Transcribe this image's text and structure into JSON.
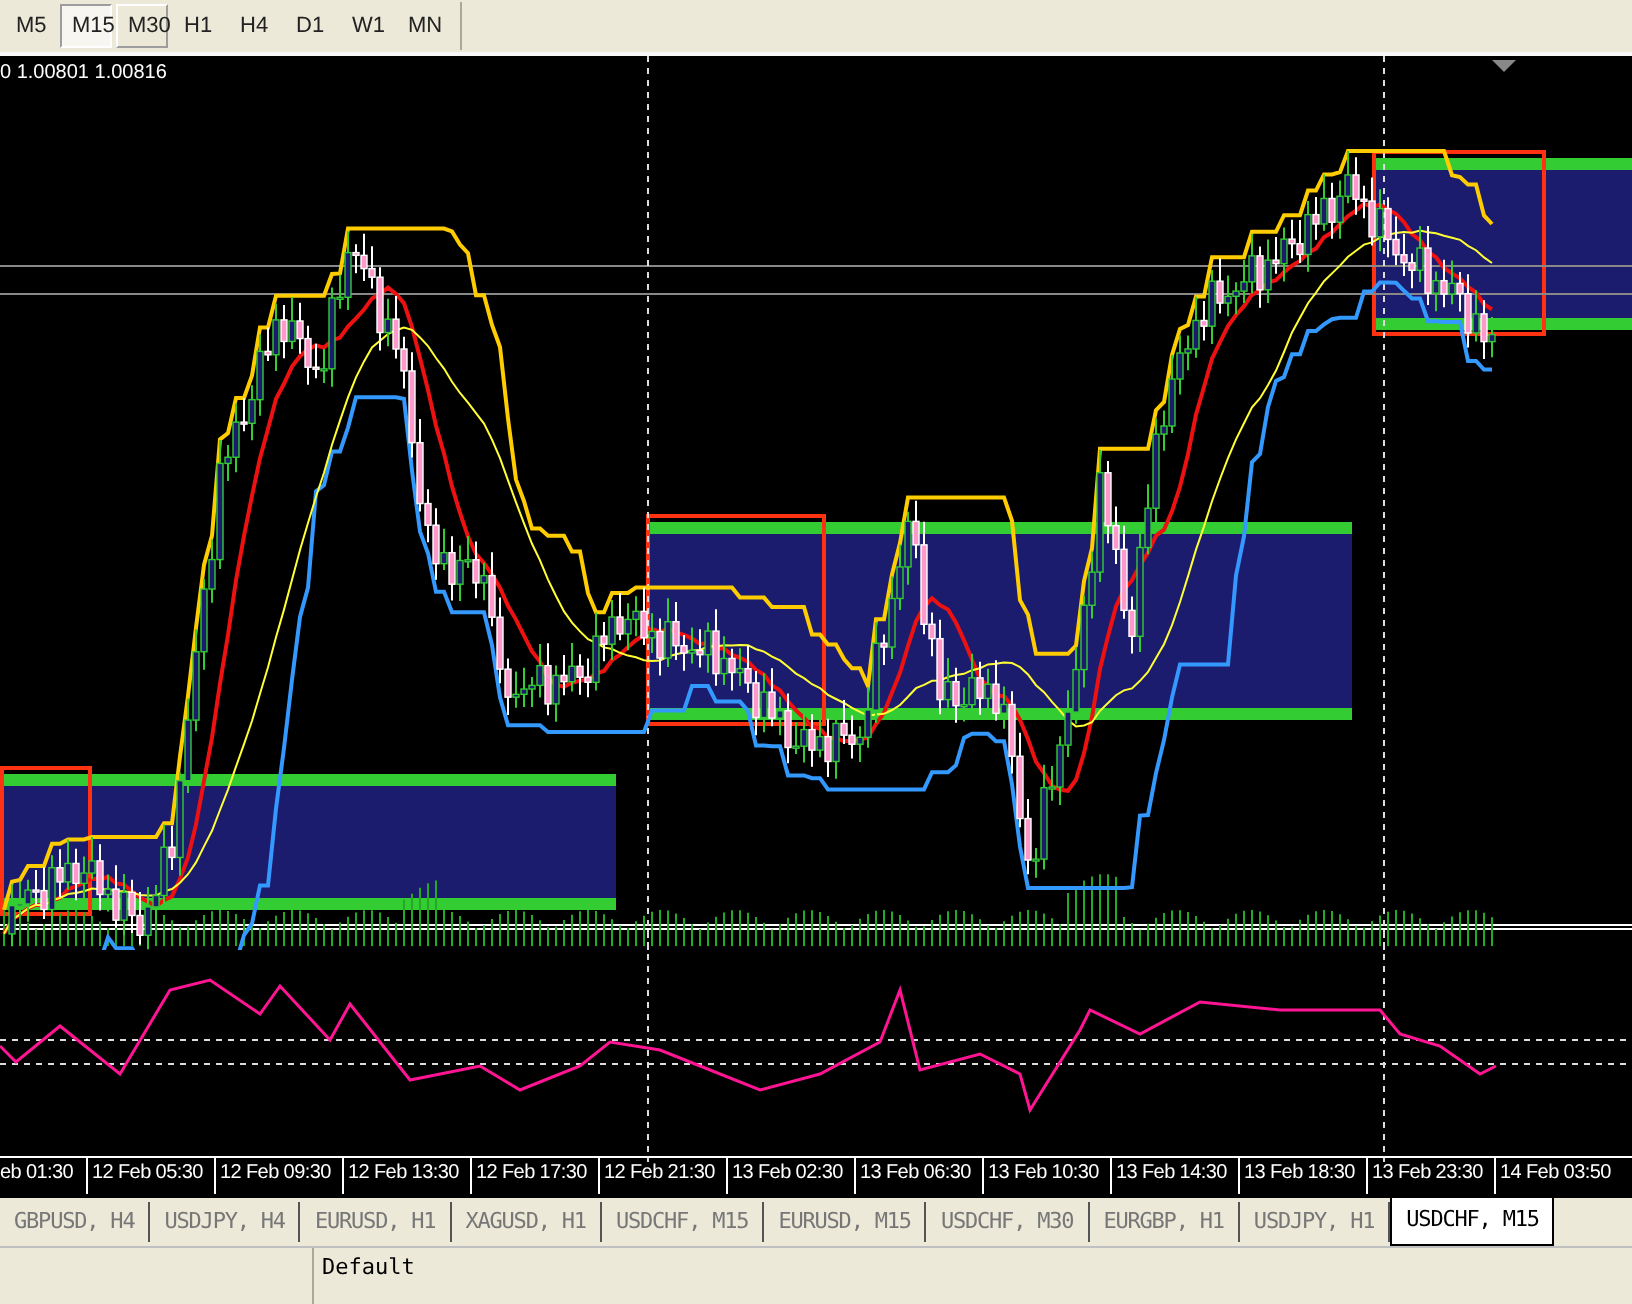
{
  "toolbar": {
    "timeframes": [
      {
        "label": "M5",
        "selected": false,
        "hover": false
      },
      {
        "label": "M15",
        "selected": true,
        "hover": false
      },
      {
        "label": "M30",
        "selected": false,
        "hover": true
      },
      {
        "label": "H1",
        "selected": false,
        "hover": false
      },
      {
        "label": "H4",
        "selected": false,
        "hover": false
      },
      {
        "label": "D1",
        "selected": false,
        "hover": false
      },
      {
        "label": "W1",
        "selected": false,
        "hover": false
      },
      {
        "label": "MN",
        "selected": false,
        "hover": false
      }
    ]
  },
  "chart": {
    "quote": "0 1.00801 1.00816",
    "time_axis": [
      "eb 01:30",
      "12 Feb 05:30",
      "12 Feb 09:30",
      "12 Feb 13:30",
      "12 Feb 17:30",
      "12 Feb 21:30",
      "13 Feb 02:30",
      "13 Feb 06:30",
      "13 Feb 10:30",
      "13 Feb 14:30",
      "13 Feb 18:30",
      "13 Feb 23:30",
      "14 Feb 03:50"
    ]
  },
  "tabs": [
    {
      "label": "GBPUSD, H4",
      "selected": false
    },
    {
      "label": "USDJPY, H4",
      "selected": false
    },
    {
      "label": "EURUSD, H1",
      "selected": false
    },
    {
      "label": "XAGUSD, H1",
      "selected": false
    },
    {
      "label": "USDCHF, M15",
      "selected": false
    },
    {
      "label": "EURUSD, M15",
      "selected": false
    },
    {
      "label": "USDCHF, M30",
      "selected": false
    },
    {
      "label": "EURGBP, H1",
      "selected": false
    },
    {
      "label": "USDJPY, H1",
      "selected": false
    },
    {
      "label": "USDCHF, M15",
      "selected": true
    }
  ],
  "status_bar": {
    "profile": "Default"
  }
}
